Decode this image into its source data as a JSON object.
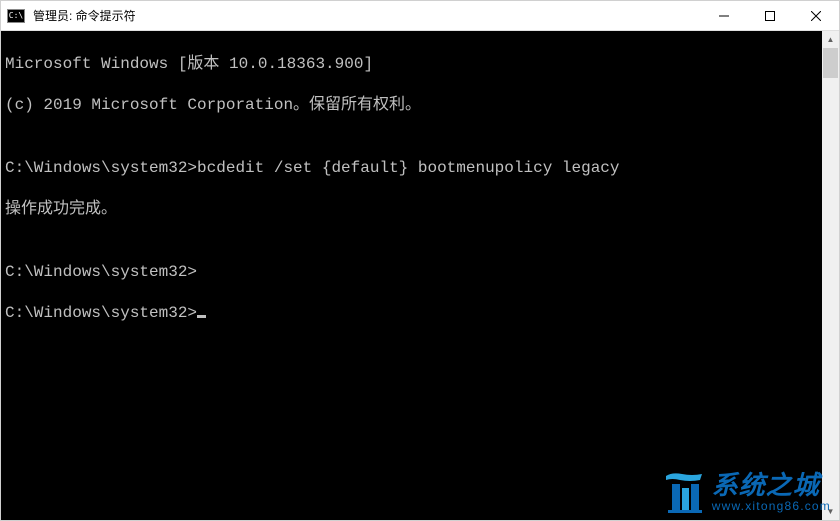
{
  "titlebar": {
    "icon_text": "C:\\",
    "title": "管理员: 命令提示符"
  },
  "terminal": {
    "line1": "Microsoft Windows [版本 10.0.18363.900]",
    "line2": "(c) 2019 Microsoft Corporation。保留所有权利。",
    "blank1": "",
    "prompt1": "C:\\Windows\\system32>",
    "command1": "bcdedit /set {default} bootmenupolicy legacy",
    "result1": "操作成功完成。",
    "blank2": "",
    "prompt2": "C:\\Windows\\system32>",
    "prompt3": "C:\\Windows\\system32>"
  },
  "watermark": {
    "title": "系统之城",
    "url": "www.xitong86.com"
  }
}
